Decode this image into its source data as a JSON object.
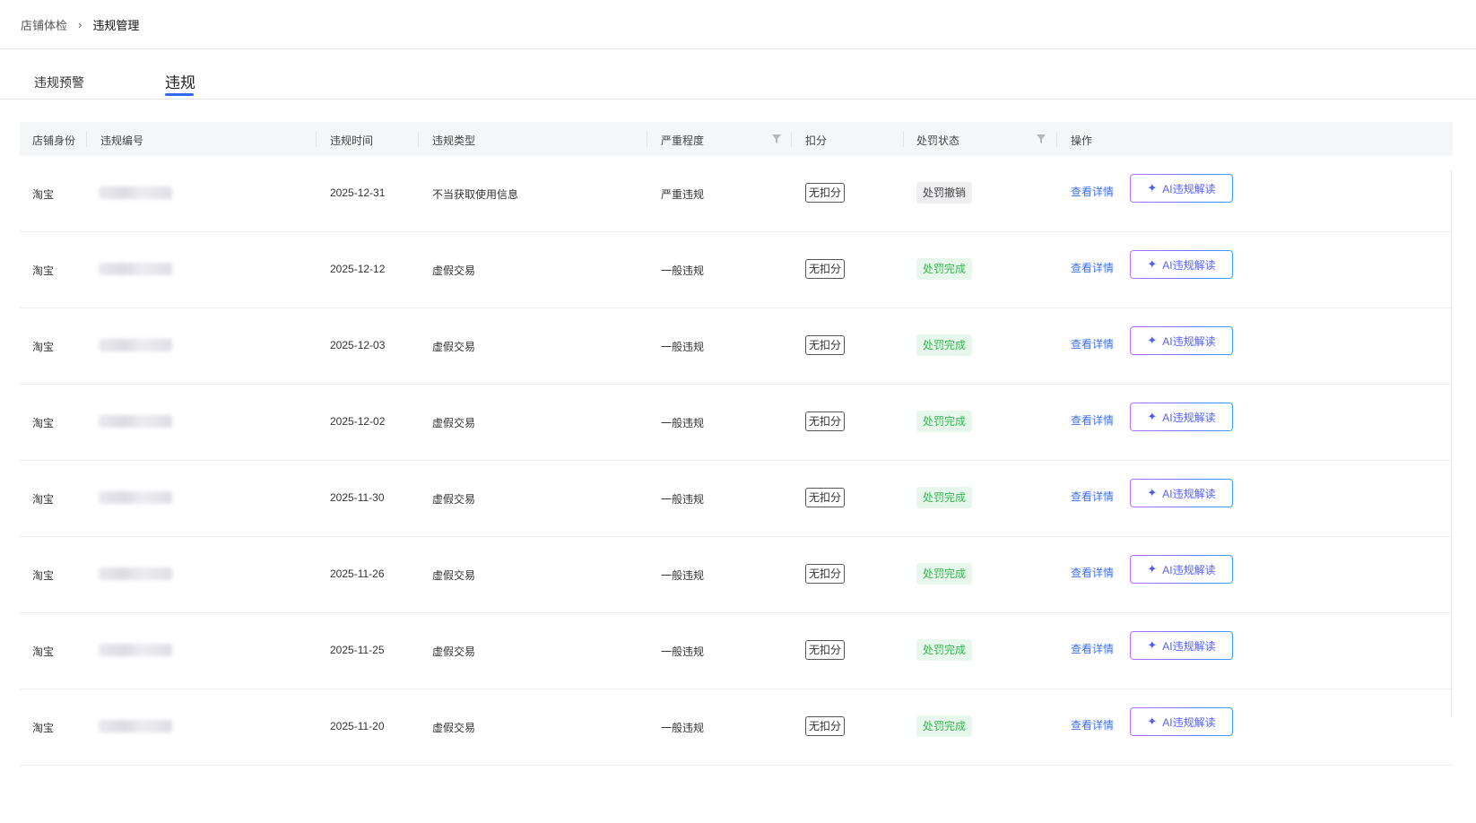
{
  "breadcrumb": {
    "parent": "店铺体检",
    "separator": "›",
    "current": "违规管理"
  },
  "tabs": {
    "warning": "违规预警",
    "violation": "违规"
  },
  "table": {
    "headers": {
      "shop_identity": "店铺身份",
      "violation_no": "违规编号",
      "violation_time": "违规时间",
      "violation_type": "违规类型",
      "severity": "严重程度",
      "deduction": "扣分",
      "penalty_status": "处罚状态",
      "actions": "操作"
    },
    "rows": [
      {
        "shop": "淘宝",
        "time": "2025-12-31",
        "type": "不当获取使用信息",
        "severity": "严重违规",
        "deduction": "无扣分",
        "status": "处罚撤销",
        "status_kind": "revoked",
        "detail": "查看详情",
        "ai": "AI违规解读"
      },
      {
        "shop": "淘宝",
        "time": "2025-12-12",
        "type": "虚假交易",
        "severity": "一般违规",
        "deduction": "无扣分",
        "status": "处罚完成",
        "status_kind": "done",
        "detail": "查看详情",
        "ai": "AI违规解读"
      },
      {
        "shop": "淘宝",
        "time": "2025-12-03",
        "type": "虚假交易",
        "severity": "一般违规",
        "deduction": "无扣分",
        "status": "处罚完成",
        "status_kind": "done",
        "detail": "查看详情",
        "ai": "AI违规解读"
      },
      {
        "shop": "淘宝",
        "time": "2025-12-02",
        "type": "虚假交易",
        "severity": "一般违规",
        "deduction": "无扣分",
        "status": "处罚完成",
        "status_kind": "done",
        "detail": "查看详情",
        "ai": "AI违规解读"
      },
      {
        "shop": "淘宝",
        "time": "2025-11-30",
        "type": "虚假交易",
        "severity": "一般违规",
        "deduction": "无扣分",
        "status": "处罚完成",
        "status_kind": "done",
        "detail": "查看详情",
        "ai": "AI违规解读"
      },
      {
        "shop": "淘宝",
        "time": "2025-11-26",
        "type": "虚假交易",
        "severity": "一般违规",
        "deduction": "无扣分",
        "status": "处罚完成",
        "status_kind": "done",
        "detail": "查看详情",
        "ai": "AI违规解读"
      },
      {
        "shop": "淘宝",
        "time": "2025-11-25",
        "type": "虚假交易",
        "severity": "一般违规",
        "deduction": "无扣分",
        "status": "处罚完成",
        "status_kind": "done",
        "detail": "查看详情",
        "ai": "AI违规解读"
      },
      {
        "shop": "淘宝",
        "time": "2025-11-20",
        "type": "虚假交易",
        "severity": "一般违规",
        "deduction": "无扣分",
        "status": "处罚完成",
        "status_kind": "done",
        "detail": "查看详情",
        "ai": "AI违规解读"
      }
    ]
  },
  "colors": {
    "accent": "#2e6bf0",
    "link": "#3c6ff0",
    "status_done_text": "#35b54f",
    "status_done_bg": "#e7f7eb",
    "status_revoked_bg": "#efeff1"
  },
  "icons": {
    "filter": "filter-icon",
    "ai": "sparkle-icon",
    "breadcrumb_separator": "chevron-right-icon"
  }
}
